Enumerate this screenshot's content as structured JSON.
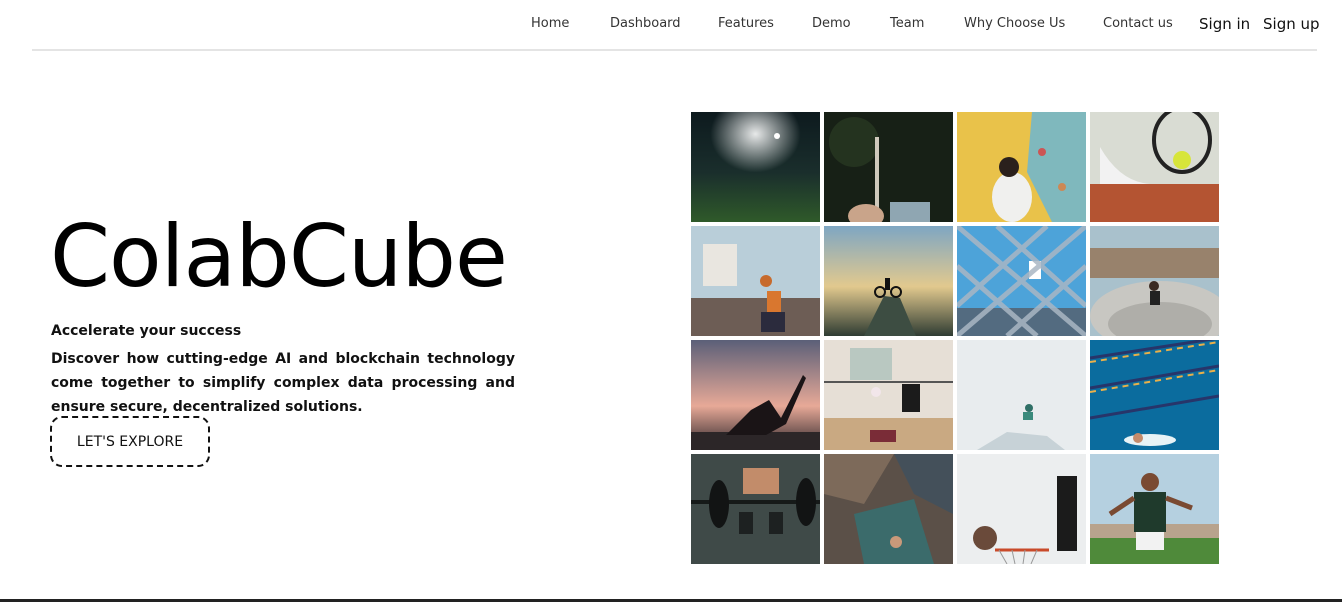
{
  "nav": {
    "links": [
      {
        "label": "Home"
      },
      {
        "label": "Dashboard"
      },
      {
        "label": "Features"
      },
      {
        "label": "Demo"
      },
      {
        "label": "Team"
      },
      {
        "label": "Why Choose Us"
      },
      {
        "label": "Contact us"
      }
    ],
    "sign_in": "Sign in",
    "sign_up": "Sign up"
  },
  "hero": {
    "title": "ColabCube",
    "tagline": "Accelerate your success",
    "description": "Discover how cutting-edge AI and blockchain technology come together to simplify complex data processing and ensure secure, decentralized solutions.",
    "cta_label": "LET'S EXPLORE"
  },
  "gallery": {
    "tiles": [
      "night-football-field-image",
      "archery-image",
      "rock-climbing-wall-image",
      "tennis-shoes-ball-image",
      "basketball-dunk-image",
      "mountain-biker-image",
      "basketball-hoop-fence-image",
      "skatepark-image",
      "yoga-sunset-image",
      "volleyball-game-image",
      "snowboard-jump-image",
      "swimming-pool-image",
      "weightlifting-barbell-image",
      "bouldering-image",
      "basketball-net-image",
      "soccer-player-image"
    ]
  }
}
